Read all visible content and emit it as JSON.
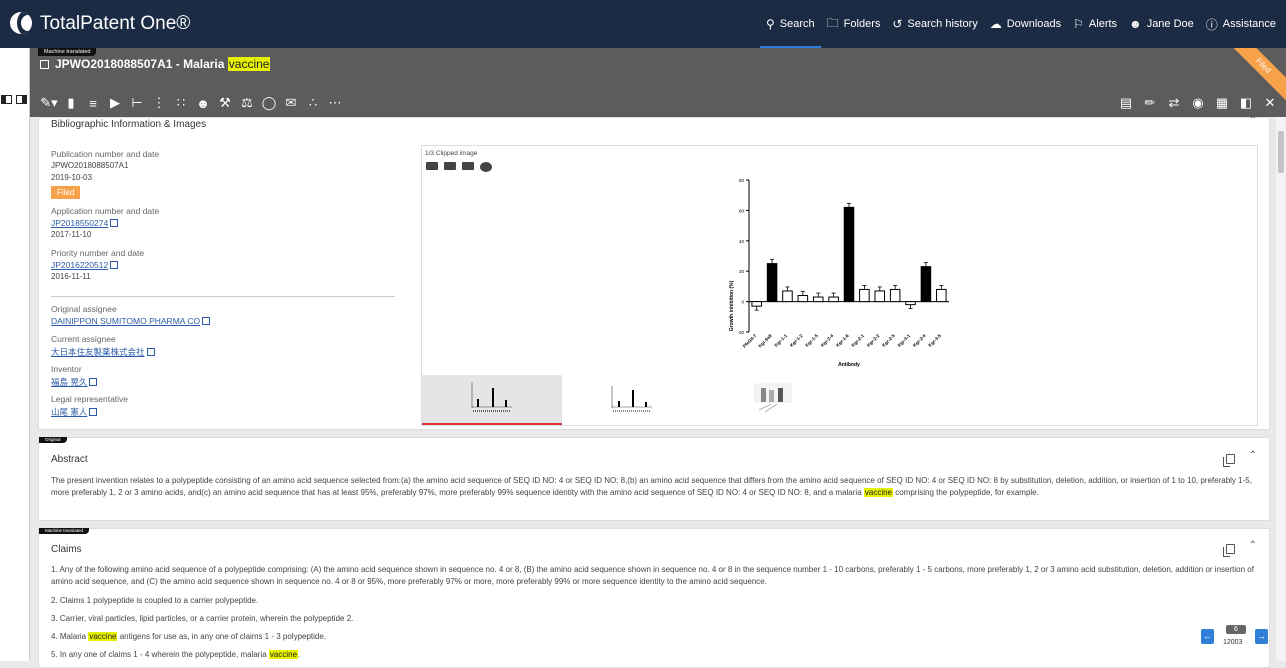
{
  "app": {
    "brand": "TotalPatent One®",
    "nav": [
      {
        "icon": "search-icon",
        "label": "Search"
      },
      {
        "icon": "folder-icon",
        "label": "Folders"
      },
      {
        "icon": "history-icon",
        "label": "Search history"
      },
      {
        "icon": "download-icon",
        "label": "Downloads"
      },
      {
        "icon": "bell-icon",
        "label": "Alerts"
      },
      {
        "icon": "user-icon",
        "label": "Jane Doe"
      },
      {
        "icon": "info-icon",
        "label": "Assistance"
      }
    ]
  },
  "doc": {
    "mt_tag": "Machine translated",
    "number": "JPWO2018088507A1 - Malaria ",
    "title_highlight": "vaccine",
    "status_ribbon": "Filed"
  },
  "biblio": {
    "title": "Bibliographic Information & Images",
    "pub_label": "Publication number and date",
    "pub_number": "JPWO2018088507A1",
    "pub_date": "2019-10-03",
    "status": "Filed",
    "app_label": "Application number and date",
    "app_number": "JP2018550274",
    "app_date": "2017-11-10",
    "prio_label": "Priority number and date",
    "prio_number": "JP2016220512",
    "prio_date": "2016-11-11",
    "orig_assignee_label": "Original assignee",
    "orig_assignee": "DAINIPPON SUMITOMO PHARMA CO",
    "cur_assignee_label": "Current assignee",
    "cur_assignee": "大日本住友製薬株式会社",
    "inventor_label": "Inventor",
    "inventor": "福島 晃久",
    "legal_label": "Legal representative",
    "legal": "山尾 憲人",
    "clip_label": "1/3 Clipped image"
  },
  "chart_data": {
    "type": "bar",
    "ylabel": "Growth inhibition (%)",
    "xlabel": "Antibody",
    "ylim": [
      -20,
      80
    ],
    "yticks": [
      -20,
      0,
      20,
      40,
      60,
      80
    ],
    "categories": [
      "PfsGII-7",
      "Kgr-9a8",
      "Kgr-1-1",
      "Kgr-1-2",
      "Kgr-1-5",
      "Kgr-2-4",
      "Kgr-1-6",
      "Kgr-2-1",
      "Kgr-2-2",
      "Kgr-2-5",
      "Kgr-3-1",
      "Kgr-2-4",
      "Kgr-3-5"
    ],
    "values": [
      -3,
      25,
      7,
      4,
      3,
      3,
      62,
      8,
      7,
      8,
      -2,
      23,
      8
    ],
    "filled": [
      false,
      true,
      false,
      false,
      false,
      false,
      true,
      false,
      false,
      false,
      false,
      true,
      false
    ]
  },
  "abstract": {
    "tag": "Original",
    "title": "Abstract",
    "text_a": "The present invention relates to a polypeptide consisting of an amino acid sequence selected from:(a) the amino acid sequence of SEQ ID NO: 4 or SEQ ID NO: 8,(b) an amino acid sequence that differs from the amino acid sequence of SEQ ID NO: 4 or SEQ ID NO: 8 by substitution, deletion, addition, or insertion of 1 to 10, preferably 1-5, more preferably 1, 2 or 3 amino acids, and(c) an amino acid sequence that has at least 95%, preferably 97%, more preferably 99% sequence identity with the amino acid sequence of SEQ ID NO: 4 or SEQ ID NO: 8, and a malaria ",
    "text_hl": "vaccine",
    "text_b": " comprising the polypeptide, for example."
  },
  "claims": {
    "tag": "Machine translated",
    "title": "Claims",
    "c1": "1. Any of the following amino acid sequence of a polypeptide comprising: (A) the amino acid sequence shown in sequence no. 4 or 8, (B) the amino acid sequence shown in sequence no. 4 or 8 in the sequence number 1 - 10 carbons, preferably 1 - 5 carbons, more preferably 1, 2 or 3 amino acid substitution, deletion, addition or insertion of amino acid sequence, and (C) the amino acid sequence shown in sequence no. 4 or 8 or 95%, more preferably 97% or more, more preferably 99% or more sequence identity to the amino acid sequence.",
    "c2": "2. Claims 1 polypeptide is coupled to a carrier polypeptide.",
    "c3": "3. Carrier, viral particles, lipid particles, or a carrier protein, wherein the polypeptide 2.",
    "c4a": "4. Malaria ",
    "c4hl": "vaccine",
    "c4b": " antigens for use as, in any one of claims 1 - 3 polypeptide.",
    "c5a": "5. In any one of claims 1 - 4 wherein the polypeptide, malaria ",
    "c5hl": "vaccine",
    "c5b": "."
  },
  "pager": {
    "current": "6",
    "total": "12003"
  }
}
